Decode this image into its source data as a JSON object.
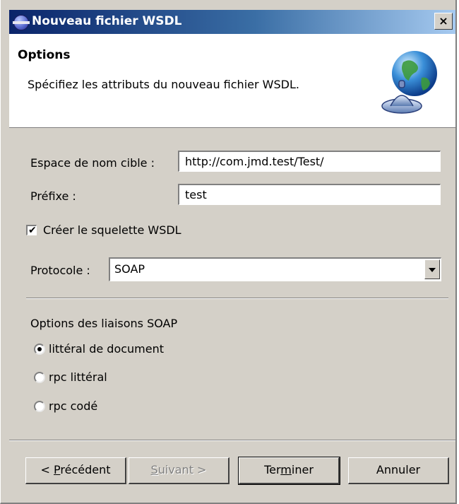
{
  "window": {
    "title": "Nouveau fichier WSDL",
    "close_label": "×"
  },
  "header": {
    "title": "Options",
    "description": "Spécifiez les attributs du nouveau fichier WSDL.",
    "image_icon": "web-service-globe-icon"
  },
  "form": {
    "namespace": {
      "label": "Espace de nom cible :",
      "value": "http://com.jmd.test/Test/"
    },
    "prefix": {
      "label": "Préfixe :",
      "value": "test"
    },
    "skeleton": {
      "label": "Créer le squelette WSDL",
      "checked": true
    },
    "protocol": {
      "label": "Protocole :",
      "value": "SOAP"
    }
  },
  "binding": {
    "title": "Options des liaisons SOAP",
    "options": [
      {
        "label": "littéral de document",
        "selected": true
      },
      {
        "label": "rpc littéral",
        "selected": false
      },
      {
        "label": "rpc codé",
        "selected": false
      }
    ]
  },
  "buttons": {
    "back": {
      "prefix": "< ",
      "accel": "P",
      "rest": "récédent",
      "enabled": true
    },
    "next": {
      "accel": "S",
      "rest": "uivant >",
      "enabled": false
    },
    "finish": {
      "before": "Ter",
      "accel": "m",
      "after": "iner",
      "enabled": true
    },
    "cancel": {
      "label": "Annuler",
      "enabled": true
    }
  },
  "colors": {
    "titlebar_start": "#0a246a",
    "titlebar_end": "#a6caf0",
    "dialog_face": "#d4d0c8"
  }
}
